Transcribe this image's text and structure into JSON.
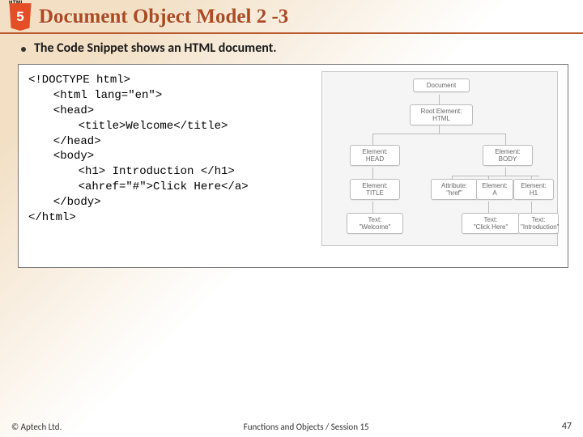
{
  "header": {
    "logo_top": "HTML",
    "logo_num": "5",
    "title": "Document Object Model 2 -3"
  },
  "bullet": "The Code Snippet shows an HTML document.",
  "code": [
    "<!DOCTYPE html>",
    "<html lang=\"en\">",
    "<head>",
    "<title>Welcome</title>",
    "</head>",
    "<body>",
    "<h1> Introduction </h1>",
    "<ahref=\"#\">Click Here</a>",
    "</body>",
    "</html>"
  ],
  "diagram": {
    "document": "Document",
    "root_l1": "Root Element:",
    "root_l2": "HTML",
    "head_l1": "Element:",
    "head_l2": "HEAD",
    "body_l1": "Element:",
    "body_l2": "BODY",
    "title_l1": "Element:",
    "title_l2": "TITLE",
    "attr_l1": "Attribute:",
    "attr_l2": "\"href\"",
    "a_l1": "Element:",
    "a_l2": "A",
    "h1_l1": "Element:",
    "h1_l2": "H1",
    "tw_l1": "Text:",
    "tw_l2": "\"Welcome\"",
    "tc_l1": "Text:",
    "tc_l2": "\"Click Here\"",
    "ti_l1": "Text:",
    "ti_l2": "\"Introduction\""
  },
  "footer": {
    "copyright": "© Aptech Ltd.",
    "center": "Functions and Objects / Session 15",
    "page": "47"
  }
}
